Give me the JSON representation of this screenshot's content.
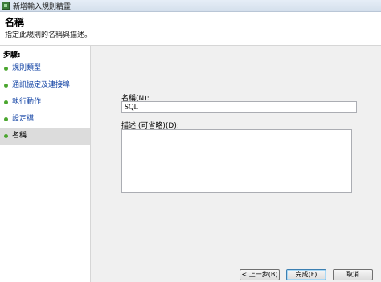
{
  "window": {
    "title": "新增輸入規則精靈",
    "icon": "firewall-icon"
  },
  "header": {
    "title": "名稱",
    "description": "指定此規則的名稱與描述。"
  },
  "steps": {
    "heading": "步驟:",
    "items": [
      {
        "label": "規則類型"
      },
      {
        "label": "通訊協定及連接埠"
      },
      {
        "label": "執行動作"
      },
      {
        "label": "設定檔"
      },
      {
        "label": "名稱"
      }
    ],
    "active_index": 4
  },
  "form": {
    "name_label": "名稱(N):",
    "name_value": "SQL",
    "description_label": "描述 (可省略)(D):",
    "description_value": ""
  },
  "buttons": {
    "back": "< 上一步(B)",
    "finish": "完成(F)",
    "cancel": "取消"
  },
  "colors": {
    "step_link": "#1646a6",
    "step_bullet": "#4aa62e",
    "active_step_bg": "#dcdcdc",
    "panel_bg": "#f0f0f0"
  }
}
